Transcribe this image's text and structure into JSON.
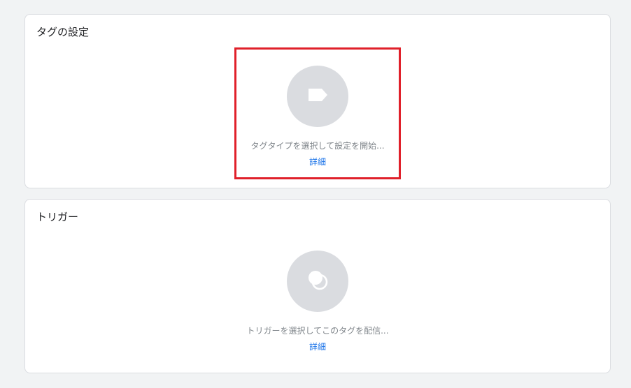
{
  "tag_config": {
    "title": "タグの設定",
    "prompt": "タグタイプを選択して設定を開始...",
    "learn_more": "詳細",
    "icon": "tag-icon"
  },
  "trigger": {
    "title": "トリガー",
    "prompt": "トリガーを選択してこのタグを配信...",
    "learn_more": "詳細",
    "icon": "trigger-icon"
  },
  "colors": {
    "background": "#f1f3f4",
    "card": "#ffffff",
    "icon_circle": "#dadce0",
    "link": "#1a73e8",
    "highlight": "#e0202a"
  }
}
